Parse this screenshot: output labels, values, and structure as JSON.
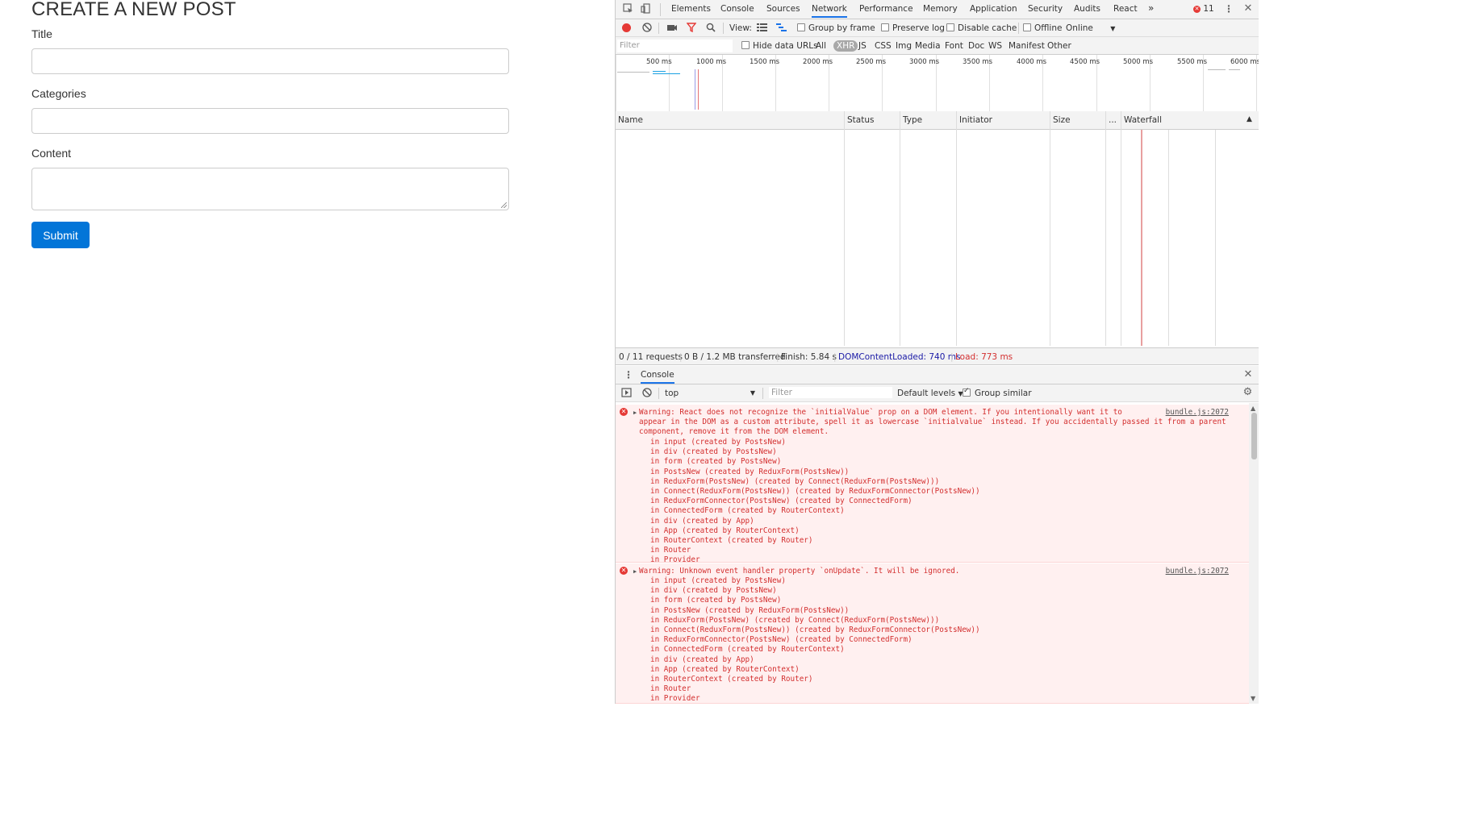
{
  "page": {
    "title": "CREATE A NEW POST",
    "fields": [
      {
        "label": "Title",
        "value": ""
      },
      {
        "label": "Categories",
        "value": ""
      },
      {
        "label": "Content",
        "value": ""
      }
    ],
    "submit_label": "Submit"
  },
  "devtools": {
    "tabs": [
      "Elements",
      "Console",
      "Sources",
      "Network",
      "Performance",
      "Memory",
      "Application",
      "Security",
      "Audits",
      "React"
    ],
    "active_tab": "Network",
    "more_tabs": "»",
    "error_count": "11",
    "toolbar": {
      "view_label": "View:",
      "group_by_frame": "Group by frame",
      "preserve_log": "Preserve log",
      "disable_cache": "Disable cache",
      "offline": "Offline",
      "throttle": "Online"
    },
    "filter": {
      "placeholder": "Filter",
      "hide_data_urls": "Hide data URLs",
      "types": [
        "All",
        "XHR",
        "JS",
        "CSS",
        "Img",
        "Media",
        "Font",
        "Doc",
        "WS",
        "Manifest",
        "Other"
      ],
      "selected_type": "XHR"
    },
    "overview_ticks": [
      "500 ms",
      "1000 ms",
      "1500 ms",
      "2000 ms",
      "2500 ms",
      "3000 ms",
      "3500 ms",
      "4000 ms",
      "4500 ms",
      "5000 ms",
      "5500 ms",
      "6000 ms"
    ],
    "columns": [
      "Name",
      "Status",
      "Type",
      "Initiator",
      "Size",
      "...",
      "Waterfall"
    ],
    "status": {
      "requests": "0 / 11 requests",
      "transferred": "0 B / 1.2 MB transferred",
      "finish": "Finish: 5.84 s",
      "dom_content_loaded": "DOMContentLoaded: 740 ms",
      "load": "Load: 773 ms"
    },
    "colors": {
      "dcl": "#1a1aa6",
      "load": "#d32f2f",
      "accent": "#1a73e8"
    },
    "console": {
      "drawer_tab": "Console",
      "context": "top",
      "filter_placeholder": "Filter",
      "levels": "Default levels",
      "group_similar": "Group similar",
      "messages": [
        {
          "text": "Warning: React does not recognize the `initialValue` prop on a DOM element. If you intentionally want it to\nappear in the DOM as a custom attribute, spell it as lowercase `initialvalue` instead. If you accidentally passed it from a parent\ncomponent, remove it from the DOM element.",
          "source": "bundle.js:2072",
          "stack": "in input (created by PostsNew)\nin div (created by PostsNew)\nin form (created by PostsNew)\nin PostsNew (created by ReduxForm(PostsNew))\nin ReduxForm(PostsNew) (created by Connect(ReduxForm(PostsNew)))\nin Connect(ReduxForm(PostsNew)) (created by ReduxFormConnector(PostsNew))\nin ReduxFormConnector(PostsNew) (created by ConnectedForm)\nin ConnectedForm (created by RouterContext)\nin div (created by App)\nin App (created by RouterContext)\nin RouterContext (created by Router)\nin Router\nin Provider"
        },
        {
          "text": "Warning: Unknown event handler property `onUpdate`. It will be ignored.",
          "source": "bundle.js:2072",
          "stack": "in input (created by PostsNew)\nin div (created by PostsNew)\nin form (created by PostsNew)\nin PostsNew (created by ReduxForm(PostsNew))\nin ReduxForm(PostsNew) (created by Connect(ReduxForm(PostsNew)))\nin Connect(ReduxForm(PostsNew)) (created by ReduxFormConnector(PostsNew))\nin ReduxFormConnector(PostsNew) (created by ConnectedForm)\nin ConnectedForm (created by RouterContext)\nin div (created by App)\nin App (created by RouterContext)\nin RouterContext (created by Router)\nin Router\nin Provider"
        }
      ]
    }
  }
}
